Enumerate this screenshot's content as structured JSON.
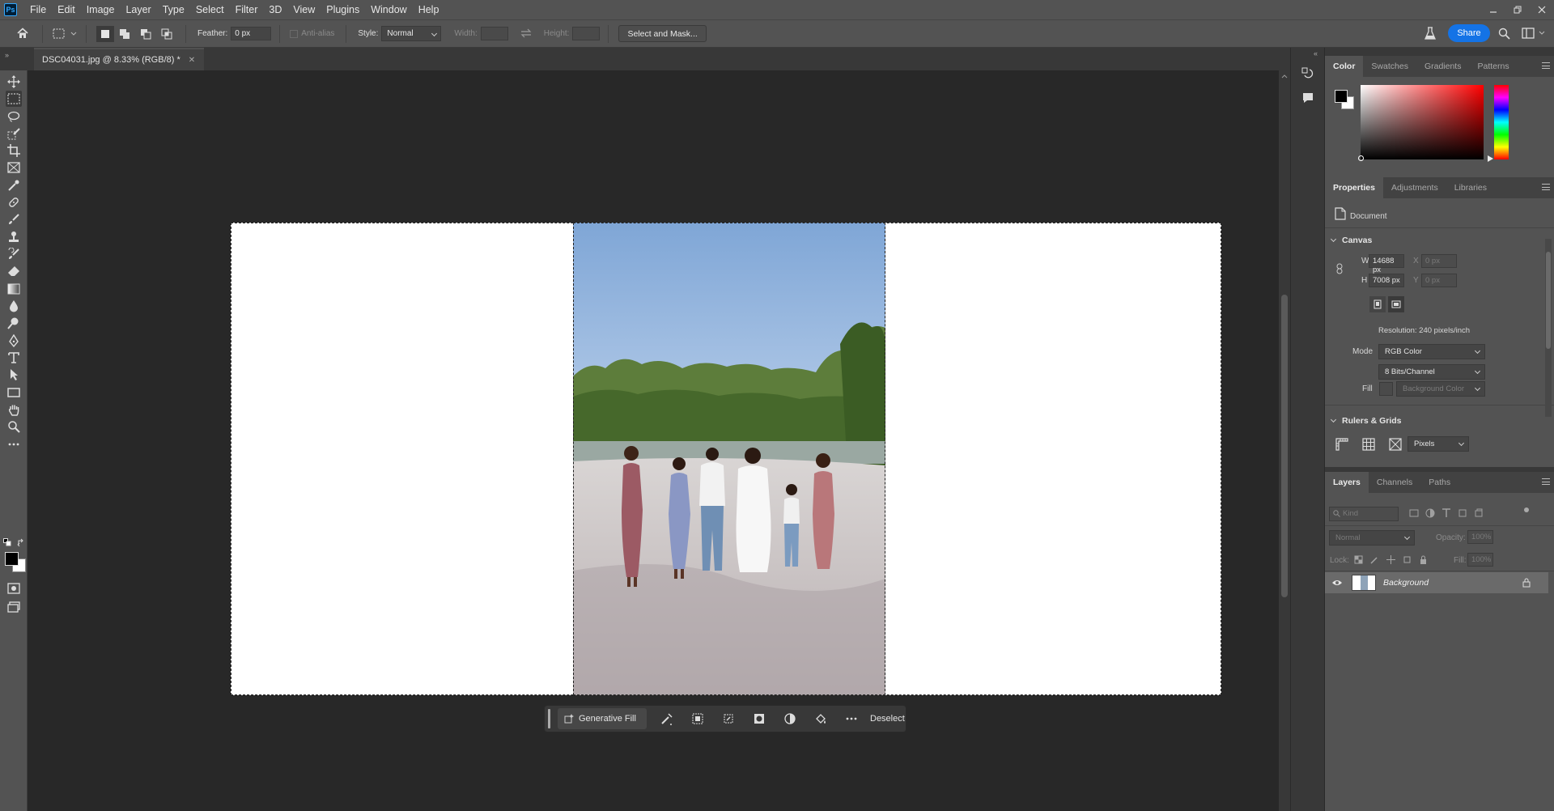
{
  "app": {
    "logo_text": "Ps"
  },
  "menu": [
    "File",
    "Edit",
    "Image",
    "Layer",
    "Type",
    "Select",
    "Filter",
    "3D",
    "View",
    "Plugins",
    "Window",
    "Help"
  ],
  "options_bar": {
    "feather_label": "Feather:",
    "feather_value": "0 px",
    "antialias_label": "Anti-alias",
    "style_label": "Style:",
    "style_value": "Normal",
    "width_label": "Width:",
    "height_label": "Height:",
    "select_mask_label": "Select and Mask...",
    "share_label": "Share"
  },
  "document_tab": {
    "title": "DSC04031.jpg @ 8.33% (RGB/8) *"
  },
  "context_bar": {
    "generative_fill": "Generative Fill",
    "deselect": "Deselect"
  },
  "color_panel": {
    "tabs": [
      "Color",
      "Swatches",
      "Gradients",
      "Patterns"
    ],
    "foreground": "#000000",
    "background": "#ffffff"
  },
  "properties_panel": {
    "tabs": [
      "Properties",
      "Adjustments",
      "Libraries"
    ],
    "document_label": "Document",
    "canvas_title": "Canvas",
    "w_label": "W",
    "w_value": "14688 px",
    "h_label": "H",
    "h_value": "7008 px",
    "x_label": "X",
    "x_placeholder": "0 px",
    "y_label": "Y",
    "y_placeholder": "0 px",
    "resolution": "Resolution: 240 pixels/inch",
    "mode_label": "Mode",
    "mode_value": "RGB Color",
    "bits_value": "8 Bits/Channel",
    "fill_label": "Fill",
    "fill_value": "Background Color",
    "rulers_title": "Rulers & Grids",
    "units_value": "Pixels"
  },
  "layers_panel": {
    "tabs": [
      "Layers",
      "Channels",
      "Paths"
    ],
    "kind_placeholder": "Kind",
    "blend_mode": "Normal",
    "opacity_label": "Opacity:",
    "opacity_value": "100%",
    "lock_label": "Lock:",
    "fill_label": "Fill:",
    "fill_value": "100%",
    "layers": [
      {
        "name": "Background",
        "visible": true,
        "locked": true
      }
    ]
  },
  "colors": {
    "accent": "#1473e6",
    "panel": "#535353",
    "canvas_bg": "#282828"
  }
}
